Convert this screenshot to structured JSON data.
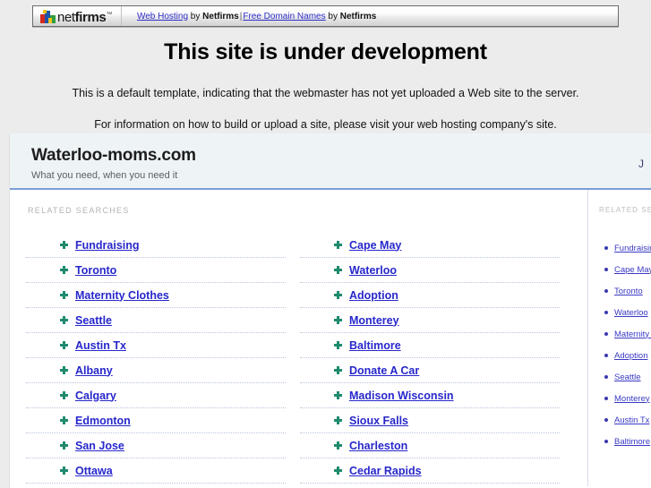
{
  "header": {
    "logo_text_light": "net",
    "logo_text_bold": "firms",
    "trademark": "™",
    "link_web_hosting": "Web Hosting",
    "by_1": " by ",
    "brand_1": "Netfirms",
    "separator": "|",
    "link_free_domains": "Free Domain Names",
    "by_2": " by ",
    "brand_2": "Netfirms"
  },
  "template": {
    "title": "This site is under development",
    "paragraph_1": "This is a default template, indicating that the webmaster has not yet uploaded a Web site to the server.",
    "paragraph_2": "For information on how to build or upload a site, please visit your web hosting company's site."
  },
  "parked": {
    "domain": "Waterloo-moms.com",
    "tagline": "What you need, when you need it",
    "head_right_clipped": "J",
    "related_searches_label": "RELATED SEARCHES",
    "columns": [
      {
        "items": [
          "Fundraising",
          "Toronto",
          "Maternity Clothes",
          "Seattle",
          "Austin Tx",
          "Albany",
          "Calgary",
          "Edmonton",
          "San Jose",
          "Ottawa"
        ]
      },
      {
        "items": [
          "Cape May",
          "Waterloo",
          "Adoption",
          "Monterey",
          "Baltimore",
          "Donate A Car",
          "Madison Wisconsin",
          "Sioux Falls",
          "Charleston",
          "Cedar Rapids"
        ]
      }
    ]
  },
  "sidebar": {
    "label": "RELATED SEARCHES",
    "items": [
      "Fundraising",
      "Cape May",
      "Toronto",
      "Waterloo",
      "Maternity Clothes",
      "Adoption",
      "Seattle",
      "Monterey",
      "Austin Tx",
      "Baltimore"
    ]
  },
  "colors": {
    "page_background": "#ececec",
    "card_background": "#ffffff",
    "parked_header_background": "#eef4f6",
    "parked_header_rule": "#7c9fd4",
    "link_blue": "#2727cc",
    "arrow_green": "#1f8a6e",
    "muted_label": "#b3b3b3"
  }
}
